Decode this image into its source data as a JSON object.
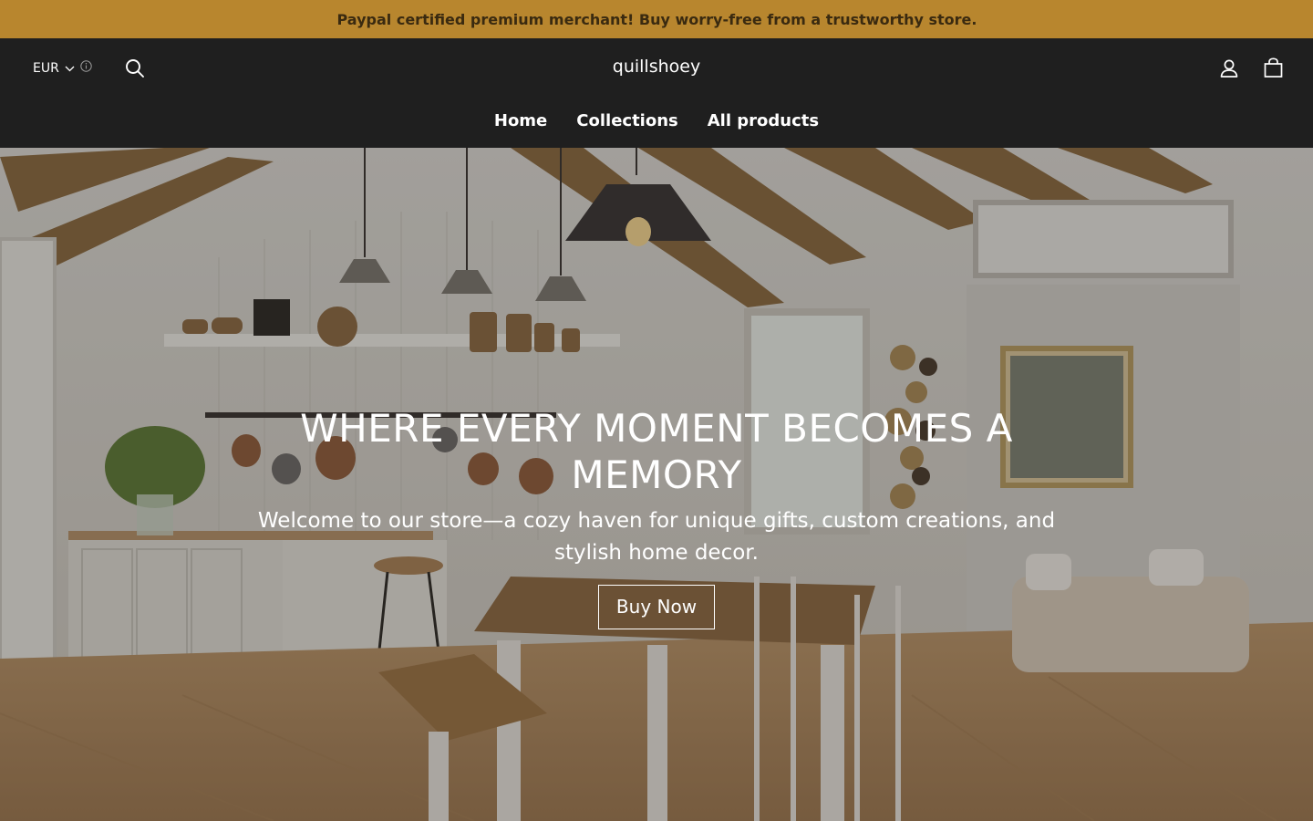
{
  "announcement": {
    "glyph": "",
    "text": "Paypal certified premium merchant! Buy worry-free from a trustworthy store."
  },
  "header": {
    "currency": "EUR",
    "brand": "quillshoey",
    "icons": [
      "search-icon",
      "account-icon",
      "cart-icon",
      "chevron-down-icon",
      "info-icon"
    ]
  },
  "nav": {
    "items": [
      {
        "label": "Home"
      },
      {
        "label": "Collections"
      },
      {
        "label": "All products"
      }
    ]
  },
  "hero": {
    "title": "WHERE EVERY MOMENT BECOMES A MEMORY",
    "subtitle": "Welcome to our store—a cozy haven for unique gifts, custom creations, and stylish home decor.",
    "button": "Buy Now"
  },
  "colors": {
    "announcement_bg": "#b8862e",
    "header_bg": "#1f1f1f",
    "text": "#ffffff"
  }
}
